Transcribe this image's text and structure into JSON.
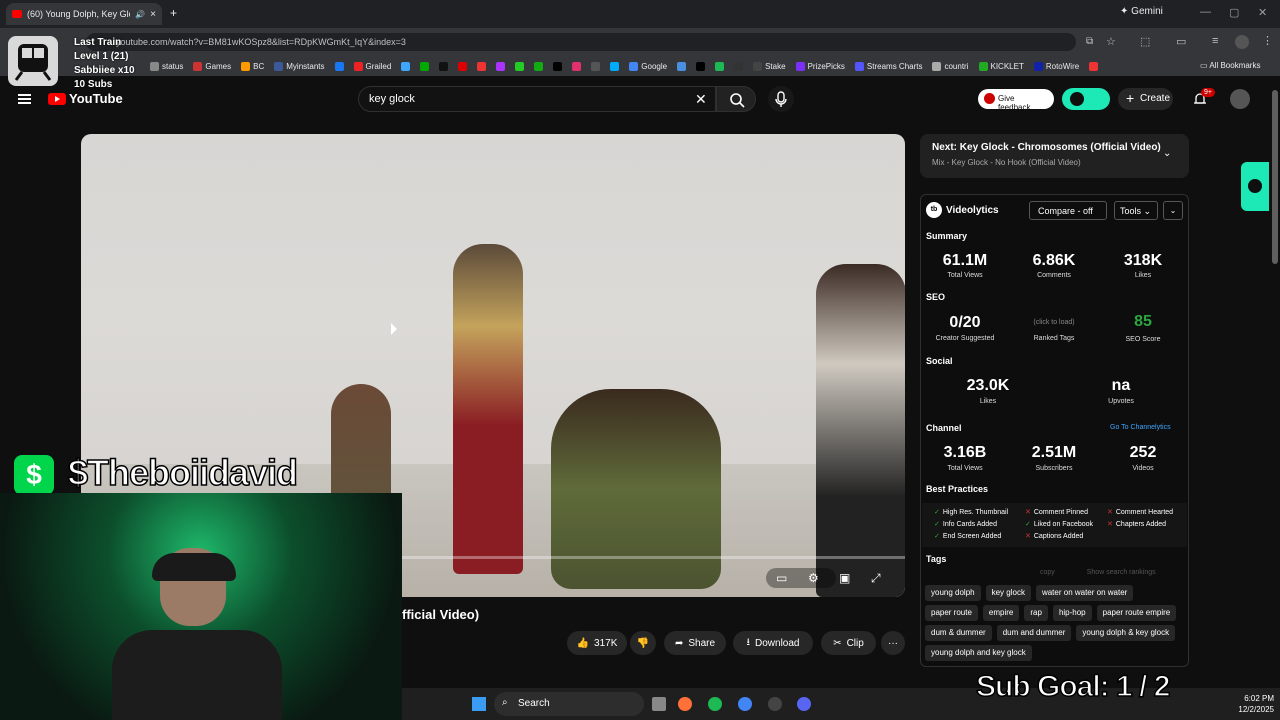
{
  "browser": {
    "tab_title": "(60) Young Dolph, Key Glock",
    "new_tab": "+",
    "gemini": "Gemini",
    "url": "youtube.com/watch?v=BM81wKOSpz8&list=RDpKWGmKt_IqY&index=3",
    "bookmarks": [
      "status",
      "Games",
      "BC",
      "Myinstants",
      "",
      "Grailed",
      "",
      "",
      "",
      "",
      "",
      "",
      "",
      "",
      "",
      "",
      "",
      "",
      "Google",
      "",
      "",
      "",
      "",
      "Stake",
      "PrizePicks",
      "Streams Charts",
      "countri",
      "KICKLET",
      "RotoWire",
      ""
    ],
    "all_bookmarks": "All Bookmarks"
  },
  "stream_overlay": {
    "train_title": "Last Train",
    "level": "Level 1  (21)",
    "sub": "Sabbiiee x10",
    "subs": "10 Subs",
    "cashtag": "$Theboiidavid",
    "cash_symbol": "$",
    "sub_goal": "Sub Goal:  1 / 2"
  },
  "youtube": {
    "logo": "YouTube",
    "search_value": "key glock",
    "give_feedback": "Give feedback",
    "create": "Create",
    "notifications": "9+",
    "video_title": "fficial Video)",
    "actions": {
      "likes": "317K",
      "share": "Share",
      "download": "Download",
      "clip": "Clip",
      "more": "···"
    }
  },
  "next": {
    "label": "Next: Key Glock - Chromosomes (Official Video)",
    "sub": "Mix - Key Glock - No Hook (Official Video)"
  },
  "videolytics": {
    "name": "Videolytics",
    "compare": "Compare - off",
    "tools": "Tools",
    "summary_title": "Summary",
    "summary": [
      {
        "value": "61.1M",
        "label": "Total Views"
      },
      {
        "value": "6.86K",
        "label": "Comments"
      },
      {
        "value": "318K",
        "label": "Likes"
      }
    ],
    "seo_title": "SEO",
    "seo": {
      "creator": "0/20",
      "creator_label": "Creator Suggested",
      "click": "(click to load)",
      "ranked": "Ranked Tags",
      "score": "85",
      "score_label": "SEO Score"
    },
    "social_title": "Social",
    "social": {
      "likes": "23.0K",
      "likes_label": "Likes",
      "upvotes": "na",
      "upvotes_label": "Upvotes"
    },
    "channel_title": "Channel",
    "channel_link": "Go To Channelytics",
    "channel": [
      {
        "value": "3.16B",
        "label": "Total Views"
      },
      {
        "value": "2.51M",
        "label": "Subscribers"
      },
      {
        "value": "252",
        "label": "Videos"
      }
    ],
    "best_title": "Best Practices",
    "best": [
      {
        "label": "High Res. Thumbnail",
        "ok": true
      },
      {
        "label": "Comment Pinned",
        "ok": false
      },
      {
        "label": "Comment Hearted",
        "ok": false
      },
      {
        "label": "Info Cards Added",
        "ok": true
      },
      {
        "label": "Liked on Facebook",
        "ok": true
      },
      {
        "label": "Chapters Added",
        "ok": false
      },
      {
        "label": "End Screen Added",
        "ok": true
      },
      {
        "label": "Captions Added",
        "ok": false
      }
    ],
    "tags_title": "Tags",
    "copy": "copy",
    "show_rankings": "Show search rankings",
    "tags": [
      [
        "young dolph",
        "key glock",
        "water on water on water"
      ],
      [
        "paper route",
        "empire",
        "rap",
        "hip-hop",
        "paper route empire"
      ],
      [
        "dum & dummer",
        "dum and dummer",
        "young dolph & key glock"
      ],
      [
        "young dolph and key glock"
      ]
    ]
  },
  "taskbar": {
    "search": "Search",
    "time": "6:02 PM",
    "date": "12/2/2025"
  },
  "colors": {
    "accent": "#1de9b6",
    "youtube_red": "#ff0000",
    "seo_score": "#2ba640",
    "cash": "#00d54b"
  }
}
